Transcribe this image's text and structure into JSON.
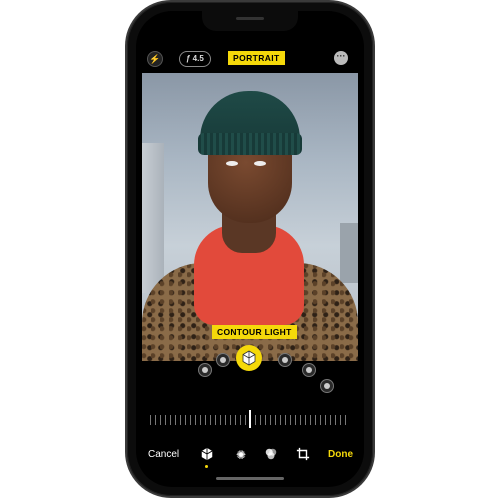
{
  "top_bar": {
    "flash_icon": "flash-icon",
    "fstop_label": "ƒ 4.5",
    "mode_label": "PORTRAIT",
    "more_icon": "ellipsis-icon"
  },
  "lighting": {
    "selected_label": "CONTOUR LIGHT",
    "selected_icon": "cube-icon",
    "options": [
      "natural-light",
      "studio-light",
      "contour-light",
      "stage-light",
      "stage-light-mono",
      "high-key-light-mono"
    ]
  },
  "bottom_bar": {
    "cancel_label": "Cancel",
    "done_label": "Done",
    "tools": [
      "lighting-cube-icon",
      "adjust-sun-icon",
      "filters-icon",
      "crop-rotate-icon"
    ]
  },
  "colors": {
    "accent": "#f5d90a",
    "background": "#000000"
  }
}
